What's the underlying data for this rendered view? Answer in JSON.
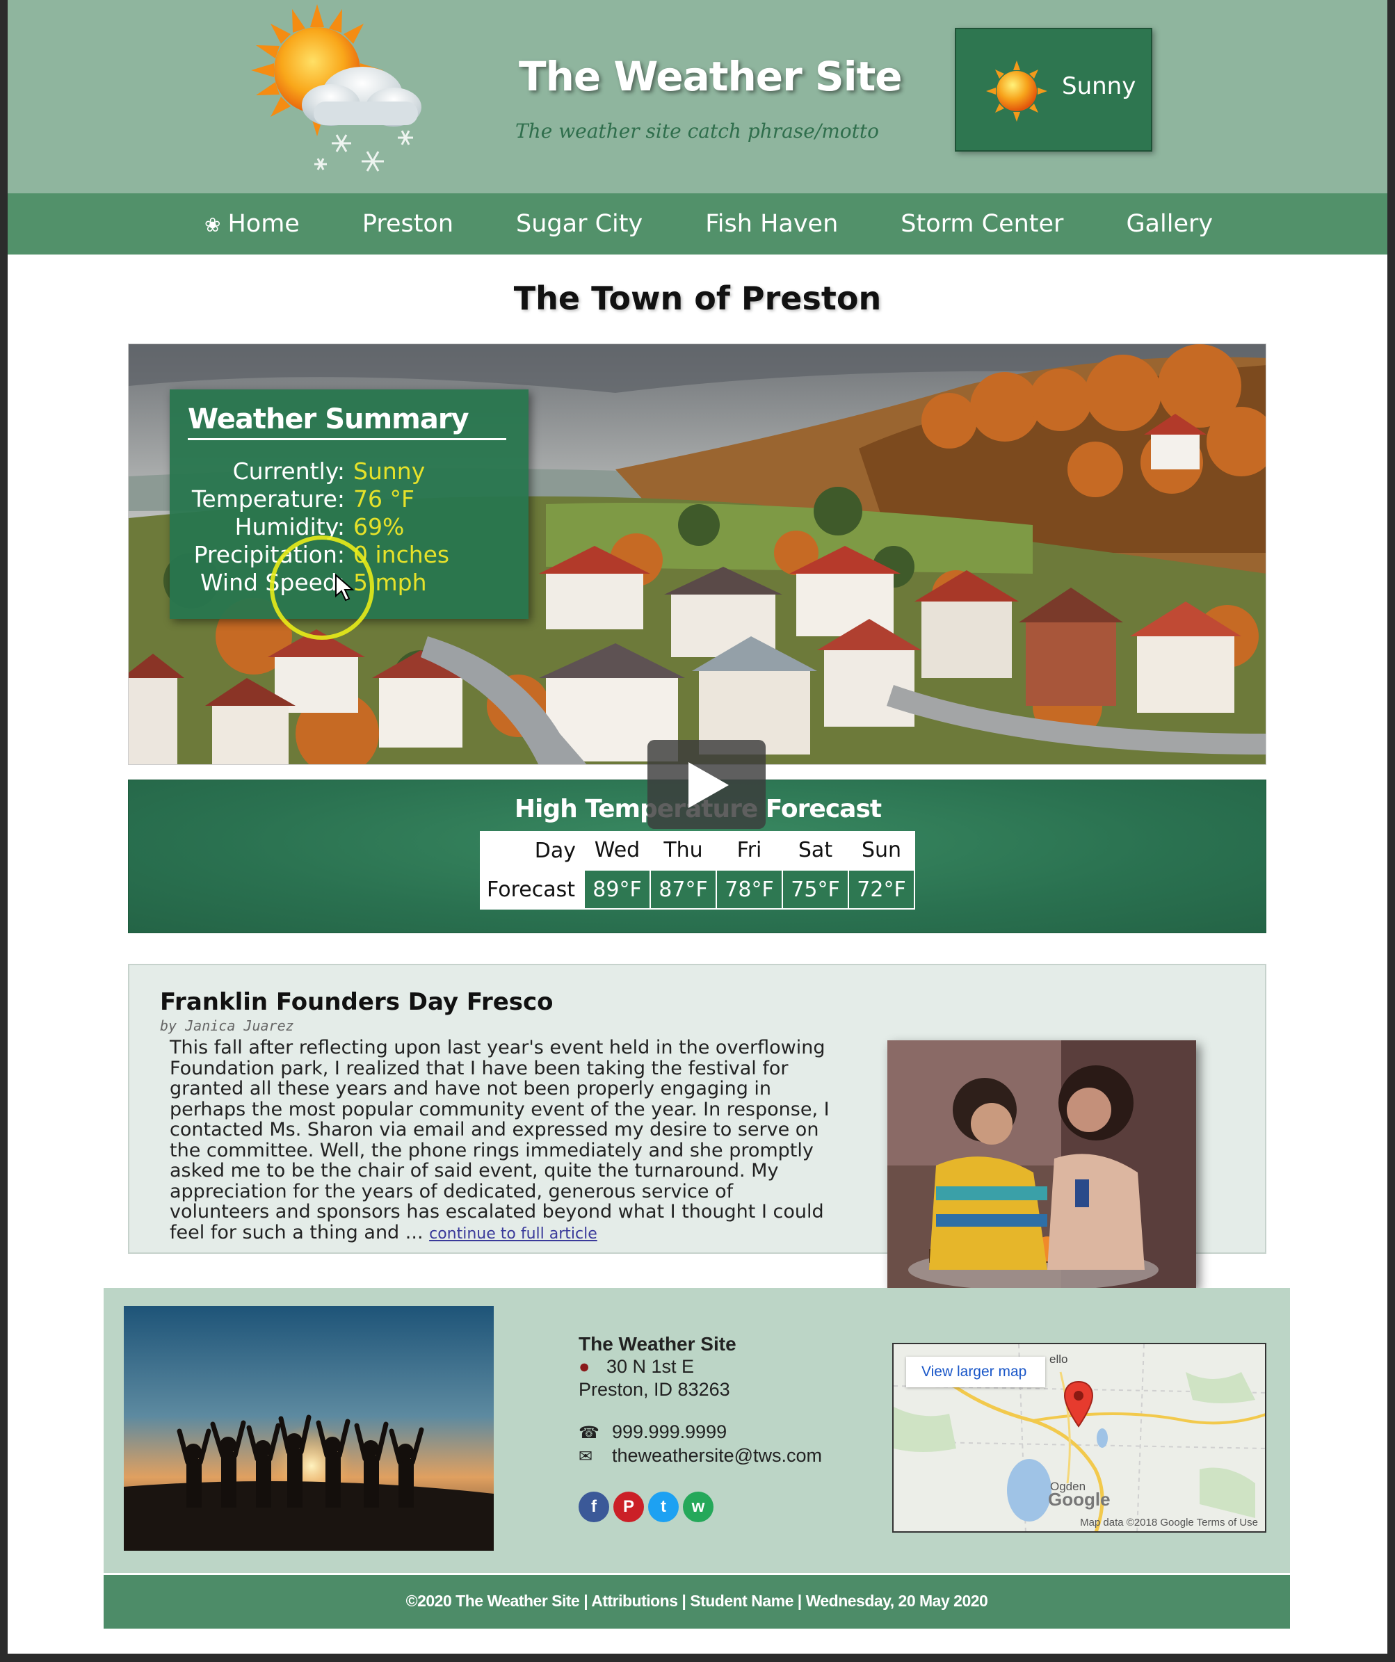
{
  "header": {
    "site_title": "The Weather Site",
    "motto": "The weather site catch phrase/motto",
    "current_condition": "Sunny",
    "logo_icon": "sun-cloud-snow-icon",
    "condition_icon": "sun-icon"
  },
  "nav": {
    "items": [
      {
        "label": "Home",
        "icon": "home-flower-icon"
      },
      {
        "label": "Preston"
      },
      {
        "label": "Sugar City"
      },
      {
        "label": "Fish Haven"
      },
      {
        "label": "Storm Center"
      },
      {
        "label": "Gallery"
      }
    ]
  },
  "page": {
    "title": "The Town of Preston"
  },
  "summary": {
    "title": "Weather Summary",
    "rows": [
      {
        "label": "Currently:",
        "value": "Sunny"
      },
      {
        "label": "Temperature:",
        "value": "76 °F"
      },
      {
        "label": "Humidity:",
        "value": "69%"
      },
      {
        "label": "Precipitation:",
        "value": "0 inches"
      },
      {
        "label": "Wind Speed:",
        "value": "5 mph"
      }
    ]
  },
  "forecast": {
    "title": "High Temperature Forecast",
    "day_header": "Day",
    "forecast_label": "Forecast",
    "days": [
      "Wed",
      "Thu",
      "Fri",
      "Sat",
      "Sun"
    ],
    "temps": [
      "89°F",
      "87°F",
      "78°F",
      "75°F",
      "72°F"
    ]
  },
  "article": {
    "title": "Franklin Founders Day Fresco",
    "byline": "by Janica Juarez",
    "body": "This fall after reflecting upon last year's event held in the overflowing Foundation park, I realized that I have been taking the festival for granted all these years and have not been properly engaging in perhaps the most popular community event of the year. In response, I contacted Ms. Sharon via email and expressed my desire to serve on the committee. Well, the phone rings immediately and she promptly asked me to be the chair of said event, quite the turnaround. My appreciation for the years of dedicated, generous service of volunteers and sponsors has escalated beyond what I thought I could feel for such a thing and ... ",
    "link_text": "continue to full article"
  },
  "footer": {
    "org": "The Weather Site",
    "address_line1": "30 N 1st E",
    "address_line2": "Preston, ID 83263",
    "phone": "999.999.9999",
    "email": "theweathersite@tws.com",
    "social": [
      {
        "name": "facebook-icon",
        "glyph": "f",
        "color": "#3b5998"
      },
      {
        "name": "pinterest-icon",
        "glyph": "P",
        "color": "#cb2027"
      },
      {
        "name": "twitter-icon",
        "glyph": "t",
        "color": "#1da1f2"
      },
      {
        "name": "whatsapp-icon",
        "glyph": "w",
        "color": "#25a85a"
      }
    ],
    "map": {
      "link_text": "View larger map",
      "attribution": "Map data ©2018 Google     Terms of Use",
      "brand": "Google",
      "city": "Ogden",
      "town": "ello"
    },
    "copyright": "©2020 The Weather Site | Attributions | Student Name | Wednesday, 20 May 2020"
  },
  "colors": {
    "header_bg": "#8fb59e",
    "nav_bg": "#52916a",
    "accent_green": "#2e7650",
    "summary_value": "#e6e22a",
    "footer_bg": "#bcd5c6"
  }
}
